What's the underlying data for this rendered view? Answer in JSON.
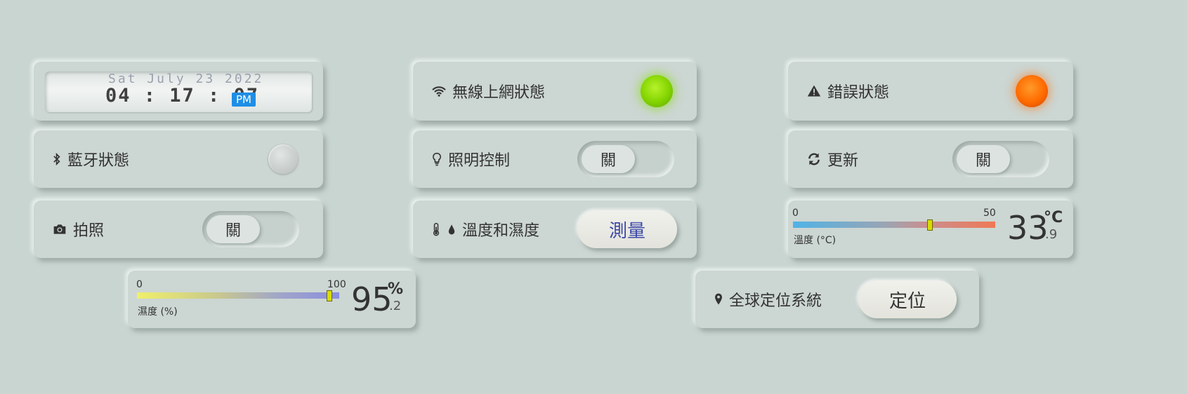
{
  "clock": {
    "date": "Sat July 23 2022",
    "time": "04 : 17 : 07",
    "ampm": "PM"
  },
  "wifi": {
    "label": "無線上網狀態",
    "status_color": "#82d300",
    "icon": "wifi-icon"
  },
  "error": {
    "label": "錯誤狀態",
    "status_color": "#ff6a00",
    "icon": "warning-icon"
  },
  "bluetooth": {
    "label": "藍牙狀態",
    "status": "off",
    "icon": "bluetooth-icon"
  },
  "lighting": {
    "label": "照明控制",
    "toggle": "關",
    "icon": "lightbulb-icon"
  },
  "refresh": {
    "label": "更新",
    "toggle": "關",
    "icon": "refresh-icon"
  },
  "camera": {
    "label": "拍照",
    "toggle": "關",
    "icon": "camera-icon"
  },
  "temp_humidity": {
    "label": "溫度和濕度",
    "button": "測量",
    "icons": [
      "thermometer-icon",
      "droplet-icon"
    ]
  },
  "temperature": {
    "min": "0",
    "max": "50",
    "caption": "溫度 (°C)",
    "value": "33",
    "decimal": ".9",
    "unit": "°C",
    "reading": 33.9
  },
  "humidity": {
    "min": "0",
    "max": "100",
    "caption": "濕度 (%)",
    "value": "95",
    "decimal": ".2",
    "unit": "%",
    "reading": 95.2
  },
  "gps": {
    "label": "全球定位系統",
    "button": "定位",
    "icon": "map-marker-icon"
  }
}
